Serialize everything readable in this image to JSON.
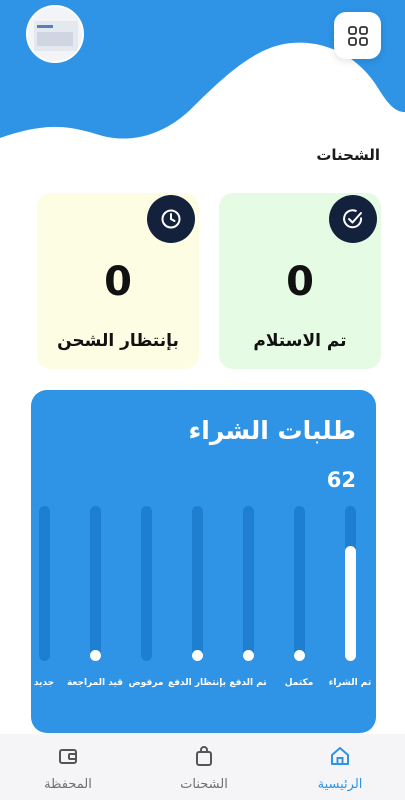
{
  "header": {
    "avatar_icon": "user-screenshot-avatar",
    "menu_icon": "grid-menu-icon",
    "colors": {
      "wave": "#2f93e6",
      "background": "#ffffff"
    }
  },
  "section": {
    "title": "الشحنات"
  },
  "stats": {
    "received": {
      "value": "0",
      "label": "تم الاستلام",
      "icon": "check-circle-icon",
      "background": "#e6fbe4"
    },
    "pending": {
      "value": "0",
      "label": "بإنتظار الشحن",
      "icon": "clock-icon",
      "background": "#fdfde3"
    }
  },
  "orders": {
    "title": "طلبات الشراء",
    "total": "62",
    "bars": [
      {
        "label": "تم الشراء",
        "level": 0.74
      },
      {
        "label": "مكتمل",
        "level": 0.02
      },
      {
        "label": "تم الدفع",
        "level": 0.02
      },
      {
        "label": "بإنتظار الدفع",
        "level": 0.02
      },
      {
        "label": "مرفوض",
        "level": 0.0
      },
      {
        "label": "قيد المراجعة",
        "level": 0.06
      },
      {
        "label": "جديد",
        "level": 0.0
      }
    ],
    "colors": {
      "panel": "#2f93e6",
      "track": "#1e7fd1",
      "fill": "#ffffff"
    }
  },
  "nav": {
    "items": [
      {
        "label": "الرئيسية",
        "icon": "home-icon",
        "active": true,
        "color": "#2f93e6"
      },
      {
        "label": "الشحنات",
        "icon": "shopping-bag-icon",
        "active": false,
        "color": "#6f6f6f"
      },
      {
        "label": "المحفظة",
        "icon": "wallet-icon",
        "active": false,
        "color": "#6f6f6f"
      }
    ]
  }
}
